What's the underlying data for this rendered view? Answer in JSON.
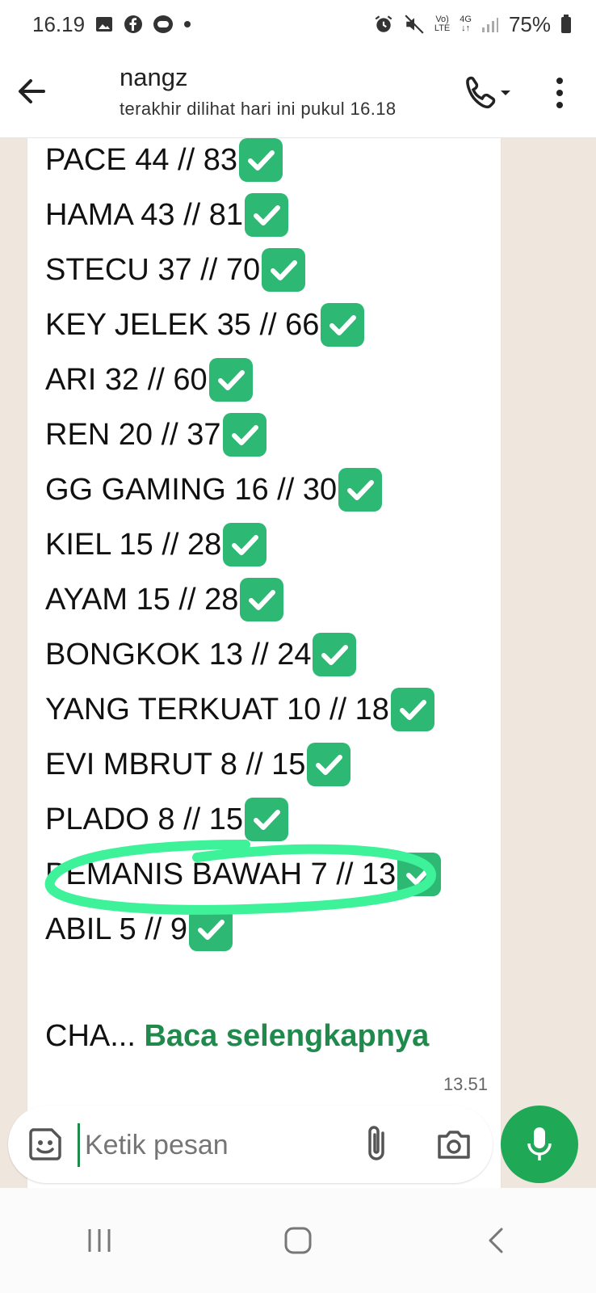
{
  "status_bar": {
    "time": "16.19",
    "volte_top": "Vo)",
    "volte_bottom": "LTE",
    "network": "4G",
    "battery": "75%"
  },
  "header": {
    "contact_name": "nangz",
    "last_seen": "terakhir dilihat hari ini pukul 16.18"
  },
  "message": {
    "lines": [
      "PACE 44 // 83",
      "HAMA 43 // 81",
      "STECU 37 // 70",
      "KEY JELEK 35 // 66",
      "ARI 32 // 60",
      "REN 20 // 37",
      "GG GAMING 16 // 30",
      "KIEL 15 // 28",
      "AYAM 15 // 28",
      "BONGKOK 13 // 24",
      "YANG TERKUAT 10 // 18",
      "EVI MBRUT 8 // 15",
      "PLADO 8 // 15",
      "PEMANIS BAWAH 7 // 13",
      "ABIL 5 // 9"
    ],
    "truncated_prefix": "CHA...",
    "read_more": "Baca selengkapnya",
    "time": "13.51"
  },
  "composer": {
    "placeholder": "Ketik pesan"
  },
  "colors": {
    "accent": "#1fa855",
    "check": "#2db874",
    "highlight": "#3ef29a"
  },
  "icons": [
    "back-arrow-icon",
    "phone-icon",
    "more-vert-icon",
    "sticker-icon",
    "attach-icon",
    "camera-icon",
    "mic-icon"
  ]
}
